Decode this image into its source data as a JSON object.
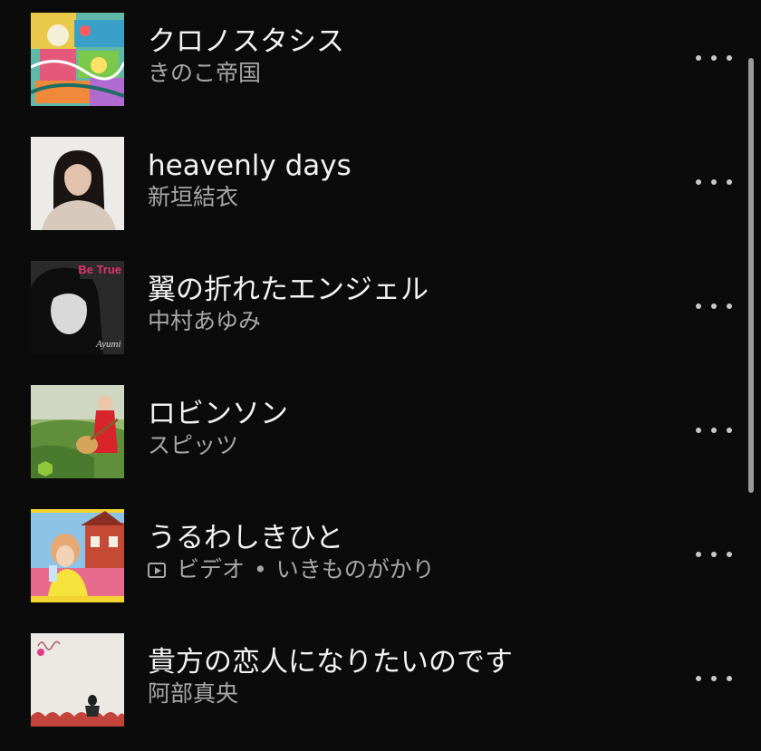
{
  "tracks": [
    {
      "title": "クロノスタシス",
      "subtitle": "きのこ帝国",
      "video": false,
      "art": "colorful-collage"
    },
    {
      "title": "heavenly days",
      "subtitle": "新垣結衣",
      "video": false,
      "art": "portrait-dark-hair"
    },
    {
      "title": "翼の折れたエンジェル",
      "subtitle": "中村あゆみ",
      "video": false,
      "art": "bw-portrait-be-true"
    },
    {
      "title": "ロビンソン",
      "subtitle": "スピッツ",
      "video": false,
      "art": "girl-guitar-red-dress"
    },
    {
      "title": "うるわしきひと",
      "subtitle_type": "ビデオ",
      "separator": "•",
      "subtitle": "いきものがかり",
      "video": true,
      "art": "girl-drink-building"
    },
    {
      "title": "貴方の恋人になりたいのです",
      "subtitle": "阿部真央",
      "video": false,
      "art": "pale-figure-red-hills"
    }
  ],
  "art_text": {
    "be_true": "Be True",
    "ayumi_signature": "Ayumi"
  }
}
